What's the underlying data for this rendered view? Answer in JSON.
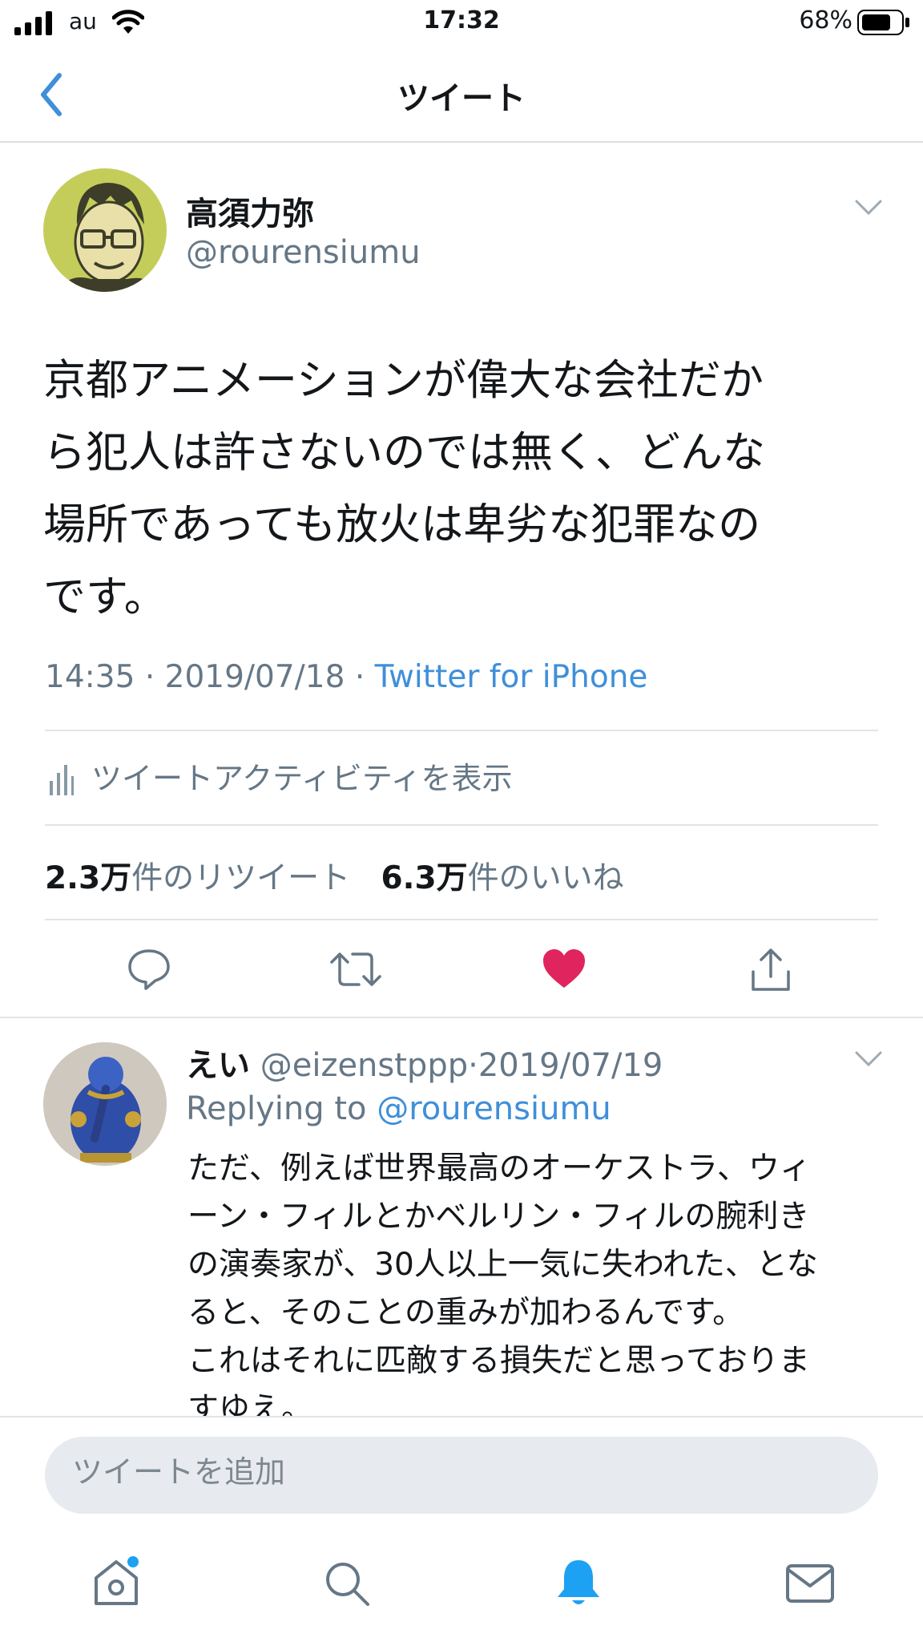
{
  "status_bar": {
    "carrier": "au",
    "time": "17:32",
    "battery": "68%"
  },
  "header": {
    "title": "ツイート"
  },
  "tweet": {
    "author_name": "高須力弥",
    "author_handle": "@rourensiumu",
    "text_lines": [
      "京都アニメーションが偉大な会社だか",
      "ら犯人は許さないのでは無く、どんな",
      "場所であっても放火は卑劣な犯罪なの",
      "です。"
    ],
    "time": "14:35",
    "date": "2019/07/18",
    "separator": "·",
    "source": "Twitter for iPhone",
    "activity_label": "ツイートアクティビティを表示",
    "retweet_count": "2.3万",
    "retweet_label": "件のリツイート",
    "like_count": "6.3万",
    "like_label": "件のいいね"
  },
  "reply": {
    "author_name": "えい",
    "author_handle": "@eizenstppp",
    "separator": "·",
    "date": "2019/07/19",
    "replying_prefix": "Replying to",
    "replying_handle": "@rourensiumu",
    "text_lines": [
      "ただ、例えば世界最高のオーケストラ、ウィ",
      "ーン・フィルとかベルリン・フィルの腕利き",
      "の演奏家が、30人以上一気に失われた、とな",
      "ると、そのことの重みが加わるんです。",
      "これはそれに匹敵する損失だと思っておりま",
      "すゆえ。"
    ]
  },
  "composer": {
    "placeholder": "ツイートを追加"
  },
  "colors": {
    "accent": "#1da1f2",
    "like": "#e0245e",
    "link": "#3f8fd9",
    "muted": "#657786"
  },
  "icons": [
    "back-chevron-icon",
    "caret-down-icon",
    "activity-chart-icon",
    "reply-icon",
    "retweet-icon",
    "like-icon",
    "share-icon",
    "home-icon",
    "search-icon",
    "notifications-icon",
    "messages-icon"
  ]
}
